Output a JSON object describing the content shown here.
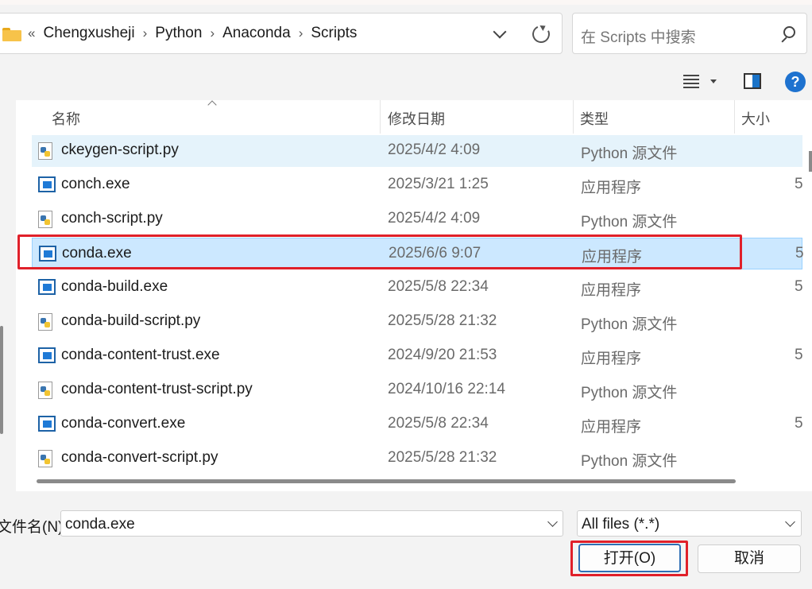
{
  "breadcrumb": {
    "overflow": "«",
    "items": [
      "Chengxusheji",
      "Python",
      "Anaconda",
      "Scripts"
    ]
  },
  "search": {
    "placeholder": "在 Scripts 中搜索"
  },
  "toolbar": {
    "help_label": "?"
  },
  "columns": {
    "name": "名称",
    "date": "修改日期",
    "type": "类型",
    "size": "大小"
  },
  "files": [
    {
      "name": "ckeygen-script.py",
      "date": "2025/4/2 4:09",
      "type": "Python 源文件",
      "size": "",
      "icon": "python-file-icon"
    },
    {
      "name": "conch.exe",
      "date": "2025/3/21 1:25",
      "type": "应用程序",
      "size": "5",
      "icon": "exe-file-icon"
    },
    {
      "name": "conch-script.py",
      "date": "2025/4/2 4:09",
      "type": "Python 源文件",
      "size": "",
      "icon": "python-file-icon"
    },
    {
      "name": "conda.exe",
      "date": "2025/6/6 9:07",
      "type": "应用程序",
      "size": "5",
      "icon": "exe-file-icon"
    },
    {
      "name": "conda-build.exe",
      "date": "2025/5/8 22:34",
      "type": "应用程序",
      "size": "5",
      "icon": "exe-file-icon"
    },
    {
      "name": "conda-build-script.py",
      "date": "2025/5/28 21:32",
      "type": "Python 源文件",
      "size": "",
      "icon": "python-file-icon"
    },
    {
      "name": "conda-content-trust.exe",
      "date": "2024/9/20 21:53",
      "type": "应用程序",
      "size": "5",
      "icon": "exe-file-icon"
    },
    {
      "name": "conda-content-trust-script.py",
      "date": "2024/10/16 22:14",
      "type": "Python 源文件",
      "size": "",
      "icon": "python-file-icon"
    },
    {
      "name": "conda-convert.exe",
      "date": "2025/5/8 22:34",
      "type": "应用程序",
      "size": "5",
      "icon": "exe-file-icon"
    },
    {
      "name": "conda-convert-script.py",
      "date": "2025/5/28 21:32",
      "type": "Python 源文件",
      "size": "",
      "icon": "python-file-icon"
    }
  ],
  "filename": {
    "label": "文件名(N):",
    "value": "conda.exe"
  },
  "filetype": {
    "value": "All files (*.*)"
  },
  "buttons": {
    "open": "打开(O)",
    "cancel": "取消"
  },
  "colors": {
    "highlight": "#e0202a",
    "selection": "#cce8ff",
    "hover": "#e5f3fb"
  }
}
